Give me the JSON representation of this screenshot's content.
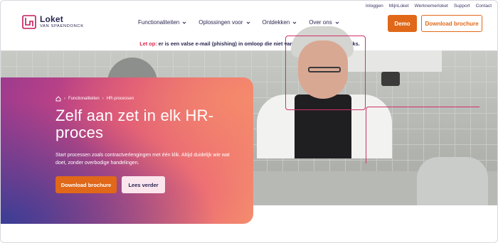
{
  "utility_nav": [
    "Inloggen",
    "MijnLoket",
    "Werknemerloket",
    "Support",
    "Contact"
  ],
  "logo": {
    "name": "Loket",
    "subtitle": "VAN SPAENDONCK"
  },
  "nav": [
    "Functionaliteiten",
    "Oplossingen voor",
    "Ontdekken",
    "Over ons"
  ],
  "header_buttons": {
    "demo": "Demo",
    "download": "Download brochure"
  },
  "alert": {
    "prefix": "Let op:",
    "message": "er is een valse e-mail (phishing) in omloop die niet van Loket is. Klik niet op links."
  },
  "breadcrumb": [
    "Functionaliteiten",
    "HR-processen"
  ],
  "hero": {
    "title": "Zelf aan zet in elk HR-proces",
    "description": "Start processen zoals contractverlengingen met één klik. Altijd duidelijk wie wat doet, zonder overbodige handelingen.",
    "primary_button": "Download brochure",
    "secondary_button": "Lees verder"
  },
  "colors": {
    "accent": "#e06818",
    "brand": "#2a2650",
    "alert_red": "#e0244a",
    "frame_pink": "#d2306a"
  }
}
